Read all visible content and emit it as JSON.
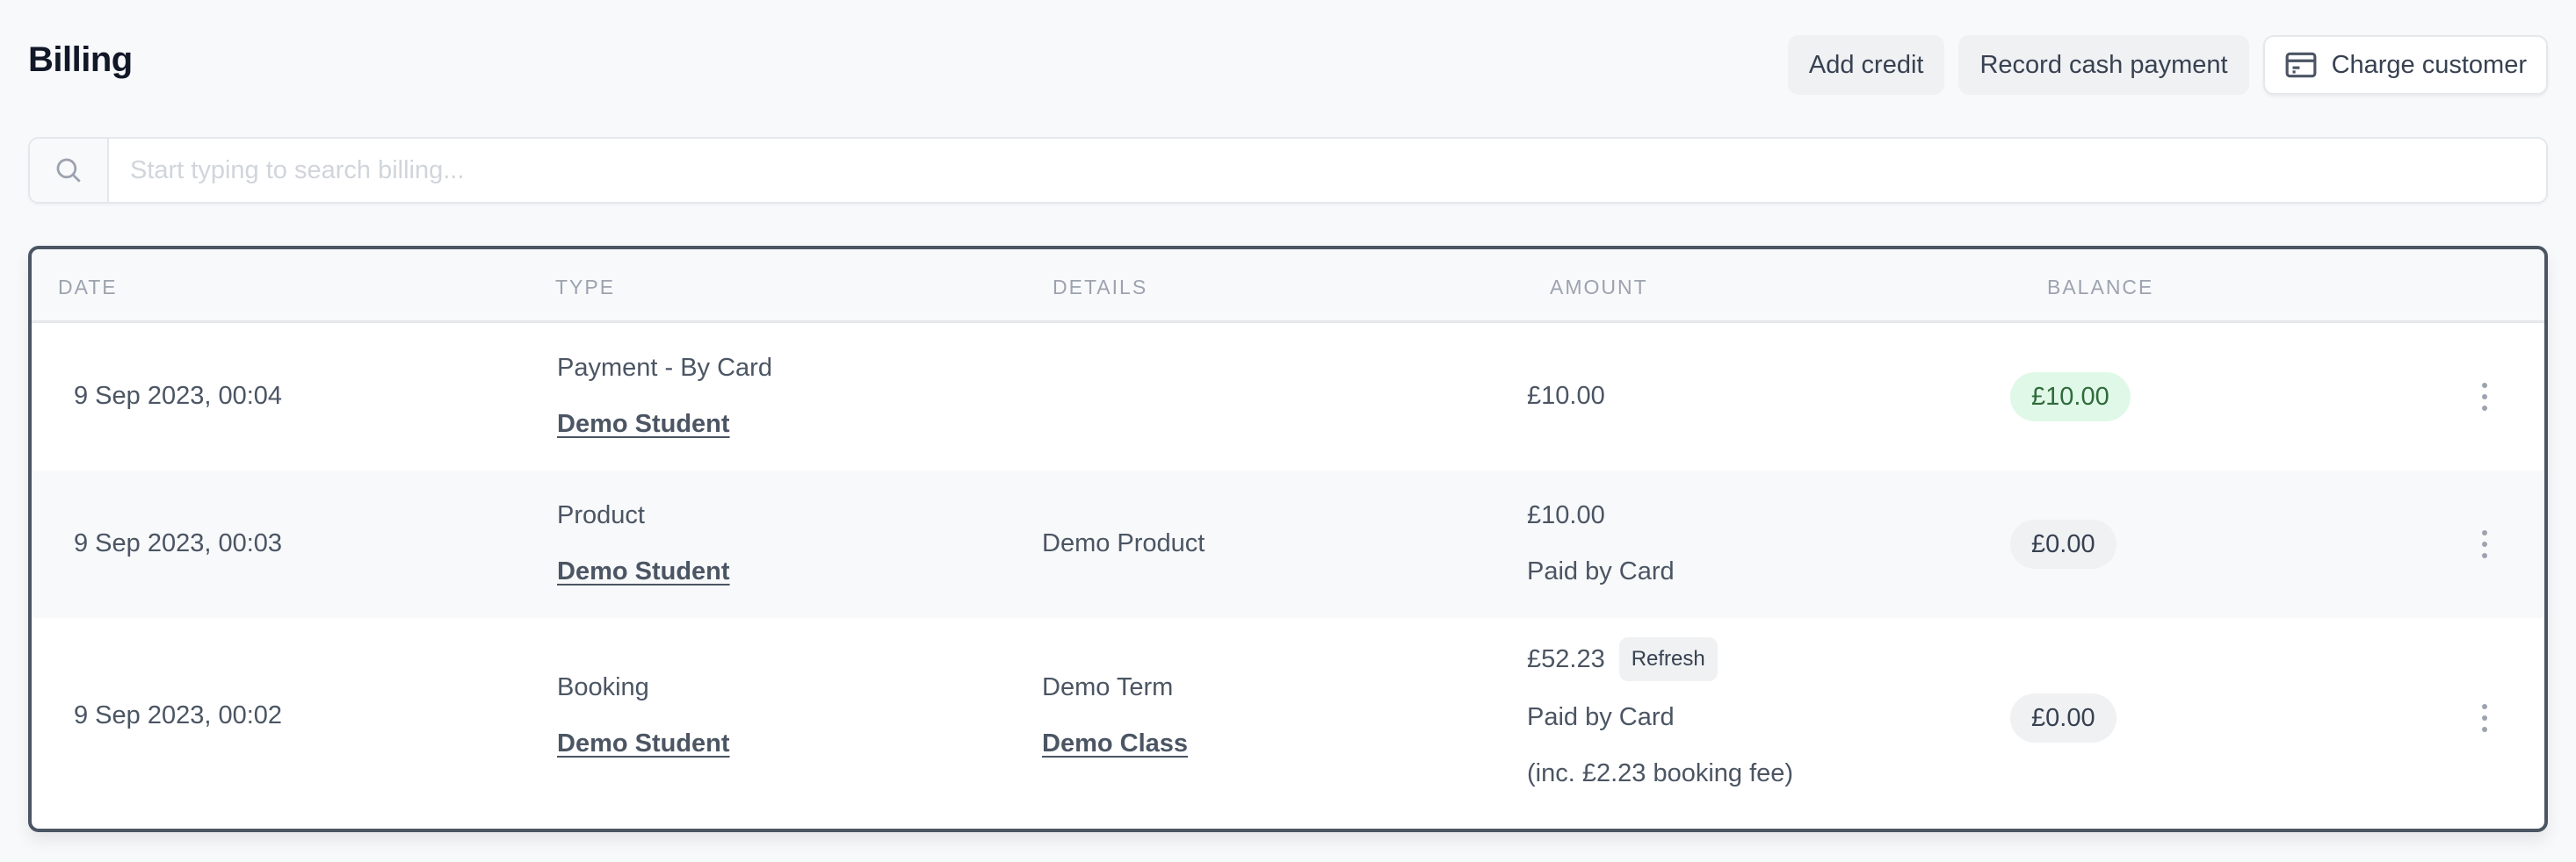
{
  "header": {
    "title": "Billing",
    "actions": {
      "add_credit": "Add credit",
      "record_cash_payment": "Record cash payment",
      "charge_customer": "Charge customer",
      "charge_customer_icon": "credit-card-icon"
    }
  },
  "search": {
    "icon": "search-icon",
    "placeholder": "Start typing to search billing...",
    "value": ""
  },
  "table": {
    "columns": [
      "Date",
      "Type",
      "Details",
      "Amount",
      "Balance"
    ],
    "rows": [
      {
        "date": "9 Sep 2023, 00:04",
        "type": "Payment - By Card",
        "customer": "Demo Student",
        "details": [],
        "amount": "£10.00",
        "amount_notes": [],
        "tag": null,
        "balance": "£10.00",
        "balance_status": "positive"
      },
      {
        "date": "9 Sep 2023, 00:03",
        "type": "Product",
        "customer": "Demo Student",
        "details": [
          "Demo Product"
        ],
        "amount": "£10.00",
        "amount_notes": [
          "Paid by Card"
        ],
        "tag": null,
        "balance": "£0.00",
        "balance_status": "neutral"
      },
      {
        "date": "9 Sep 2023, 00:02",
        "type": "Booking",
        "customer": "Demo Student",
        "details": [
          "Demo Term",
          "Demo Class"
        ],
        "amount": "£52.23",
        "amount_notes": [
          "Paid by Card",
          "(inc. £2.23 booking fee)"
        ],
        "tag": "Refresh",
        "balance": "£0.00",
        "balance_status": "neutral"
      }
    ]
  },
  "colors": {
    "positive_balance_bg": "#e0f8e8",
    "positive_balance_text": "#2f6b3b",
    "neutral_balance_bg": "#f0f1f3",
    "card_border": "#4b5563"
  }
}
